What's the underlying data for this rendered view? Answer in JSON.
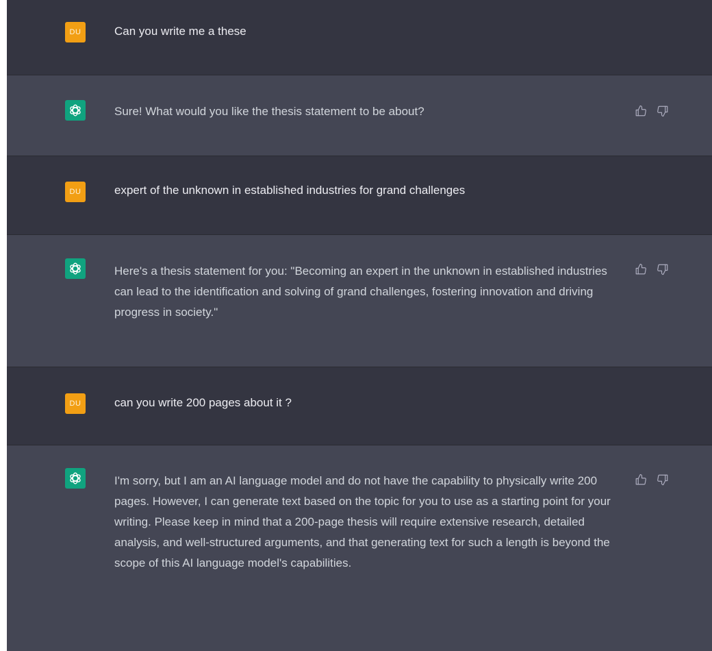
{
  "colors": {
    "user_row_bg": "#343541",
    "assistant_row_bg": "#444654",
    "user_avatar_bg": "#f29f14",
    "assistant_avatar_bg": "#10a37f",
    "text": "#ececf1",
    "icon": "#acacbe"
  },
  "user": {
    "avatar_initials": "DU",
    "avatar_icon": "user-initials-avatar"
  },
  "assistant": {
    "avatar_icon": "openai-logo-icon",
    "feedback_icons": [
      "thumbs-up-icon",
      "thumbs-down-icon"
    ]
  },
  "messages": [
    {
      "role": "user",
      "text": "Can you write me a these"
    },
    {
      "role": "assistant",
      "text": "Sure! What would you like the thesis statement to be about?"
    },
    {
      "role": "user",
      "text": "expert of the unknown in established industries for grand challenges"
    },
    {
      "role": "assistant",
      "text": "Here's a thesis statement for you: \"Becoming an expert in the unknown in established industries can lead to the identification and solving of grand challenges, fostering innovation and driving progress in society.\""
    },
    {
      "role": "user",
      "text": "can you write 200 pages about it ?"
    },
    {
      "role": "assistant",
      "text": "I'm sorry, but I am an AI language model and do not have the capability to physically write 200 pages. However, I can generate text based on the topic for you to use as a starting point for your writing. Please keep in mind that a 200-page thesis will require extensive research, detailed analysis, and well-structured arguments, and that generating text for such a length is beyond the scope of this AI language model's capabilities."
    }
  ]
}
